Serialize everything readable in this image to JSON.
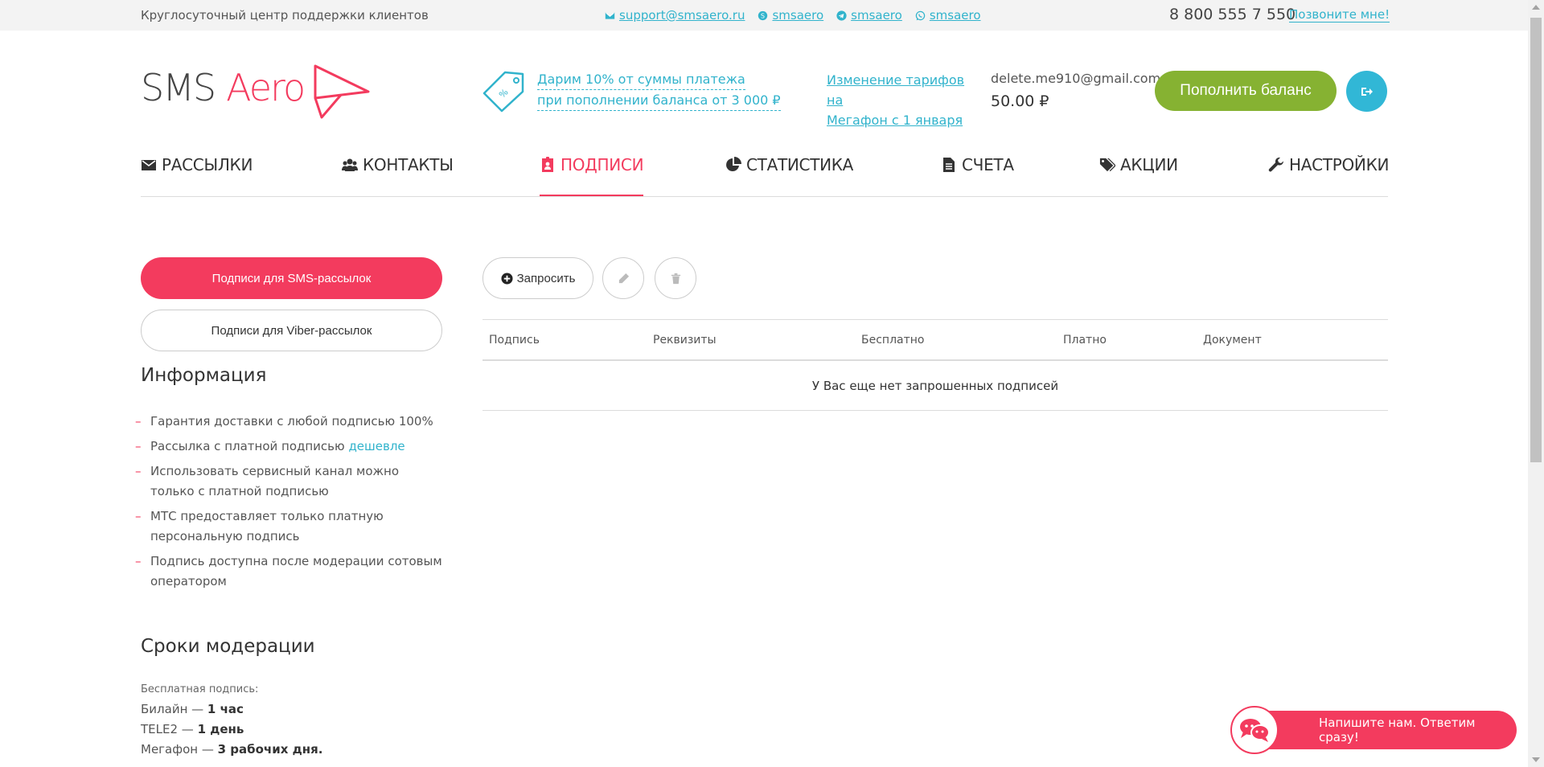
{
  "topbar": {
    "support_text": "Круглосуточный центр поддержки клиентов",
    "email": "support@smsaero.ru",
    "skype": "smsaero",
    "telegram": "smsaero",
    "whatsapp": "smsaero",
    "phone": "8 800 555 7 550",
    "callme": "Позвоните мне!"
  },
  "header": {
    "logo_sms": "SMS",
    "logo_aero": "Aero",
    "promo_line1": "Дарим 10% от суммы платежа",
    "promo_line2": "при пополнении баланса от 3 000 ₽",
    "tariff_line1": "Изменение тарифов на",
    "tariff_line2": "Мегафон с 1 января",
    "account_email": "delete.me910@gmail.com",
    "balance": "50.00 ₽",
    "topup_label": "Пополнить баланс"
  },
  "nav": [
    {
      "label": "РАССЫЛКИ",
      "icon": "envelope-icon"
    },
    {
      "label": "КОНТАКТЫ",
      "icon": "users-icon"
    },
    {
      "label": "ПОДПИСИ",
      "icon": "badge-icon",
      "active": true
    },
    {
      "label": "СТАТИСТИКА",
      "icon": "pie-chart-icon"
    },
    {
      "label": "СЧЕТА",
      "icon": "document-icon"
    },
    {
      "label": "АКЦИИ",
      "icon": "tags-icon"
    },
    {
      "label": "НАСТРОЙКИ",
      "icon": "wrench-icon"
    }
  ],
  "sidebar": {
    "btn_sms": "Подписи для SMS-рассылок",
    "btn_viber": "Подписи для Viber-рассылок",
    "info_title": "Информация",
    "info_items": [
      "Гарантия доставки с любой подписью 100%",
      "Рассылка с платной подписью",
      "Использовать сервисный канал можно только с платной подписью",
      "МТС предоставляет только платную персональную подпись",
      "Подпись доступна после модерации сотовым оператором"
    ],
    "cheaper_link": "дешевле",
    "moderation_title": "Сроки модерации",
    "free_label": "Бесплатная подпись:",
    "operators": [
      {
        "name": "Билайн — ",
        "time": "1 час"
      },
      {
        "name": "TELE2 — ",
        "time": "1 день"
      },
      {
        "name": "Мегафон — ",
        "time": "3 рабочих дня."
      }
    ]
  },
  "main": {
    "request_label": "Запросить",
    "columns": [
      "Подпись",
      "Реквизиты",
      "Бесплатно",
      "Платно",
      "Документ"
    ],
    "empty_text": "У Вас еще нет запрошенных подписей"
  },
  "chat": {
    "label": "Напишите нам. Ответим сразу!"
  },
  "colors": {
    "accent": "#f33b5e",
    "link": "#31b3cc",
    "green": "#86b232",
    "logout": "#31b7d6"
  }
}
